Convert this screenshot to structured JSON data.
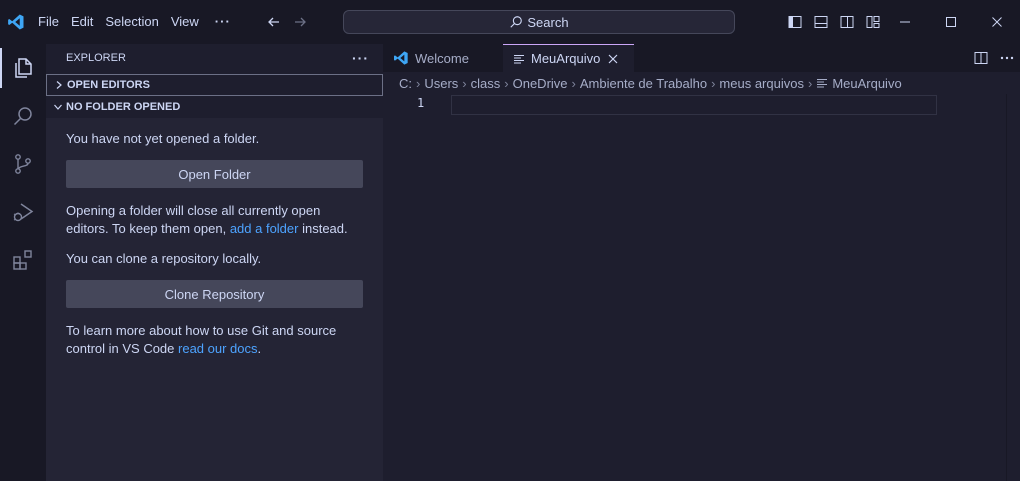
{
  "titlebar": {
    "menu": [
      "File",
      "Edit",
      "Selection",
      "View"
    ],
    "more_label": "···",
    "search_label": "Search"
  },
  "sidebar": {
    "title": "EXPLORER",
    "more_label": "···",
    "sections": {
      "open_editors": "OPEN EDITORS",
      "no_folder": "NO FOLDER OPENED"
    },
    "welcome": {
      "text1": "You have not yet opened a folder.",
      "open_folder_button": "Open Folder",
      "text2_before": "Opening a folder will close all currently open editors. To keep them open, ",
      "text2_link": "add a folder",
      "text2_after": " instead.",
      "text3": "You can clone a repository locally.",
      "clone_button": "Clone Repository",
      "text4_before": "To learn more about how to use Git and source control in VS Code ",
      "text4_link": "read our docs",
      "text4_after": "."
    }
  },
  "editor": {
    "tabs": [
      {
        "label": "Welcome"
      },
      {
        "label": "MeuArquivo"
      }
    ],
    "breadcrumbs": [
      "C:",
      "Users",
      "class",
      "OneDrive",
      "Ambiente de Trabalho",
      "meus arquivos",
      "MeuArquivo"
    ],
    "line_number": "1"
  },
  "colors": {
    "accent": "#cba6f7",
    "link": "#4da3ff",
    "vscode_blue": "#3ea6f5"
  }
}
